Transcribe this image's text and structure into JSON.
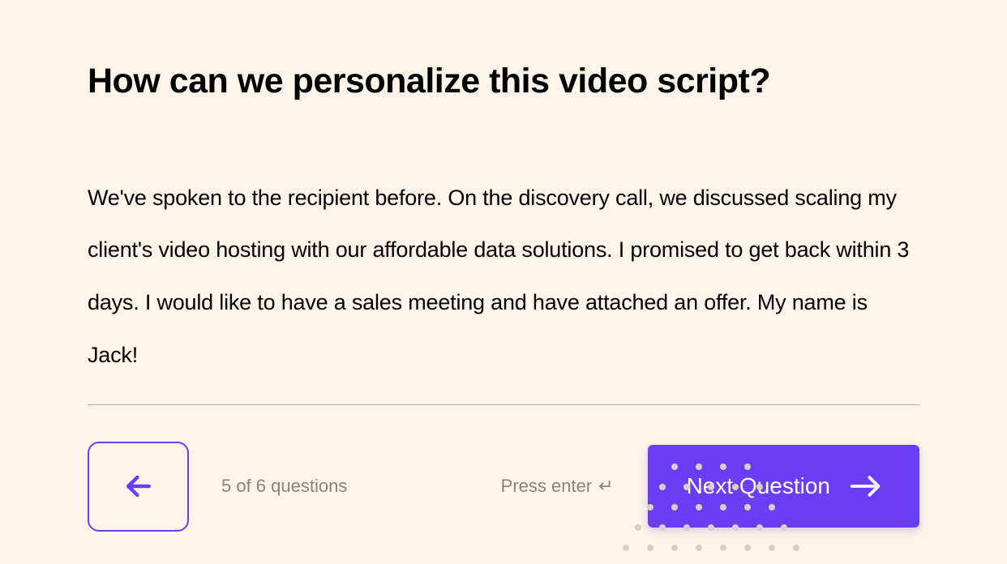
{
  "question": {
    "title": "How can we personalize this video script?",
    "answer": "We've spoken to the recipient before. On the discovery call, we discussed scaling my client's video hosting with our affordable data solutions. I promised to get back within 3 days. I would like to have a sales meeting and have attached an offer. My name is Jack!"
  },
  "progress": {
    "text": "5 of 6 questions"
  },
  "hint": {
    "label": "Press enter",
    "symbol": "↵"
  },
  "buttons": {
    "next_label": "Next Question"
  }
}
